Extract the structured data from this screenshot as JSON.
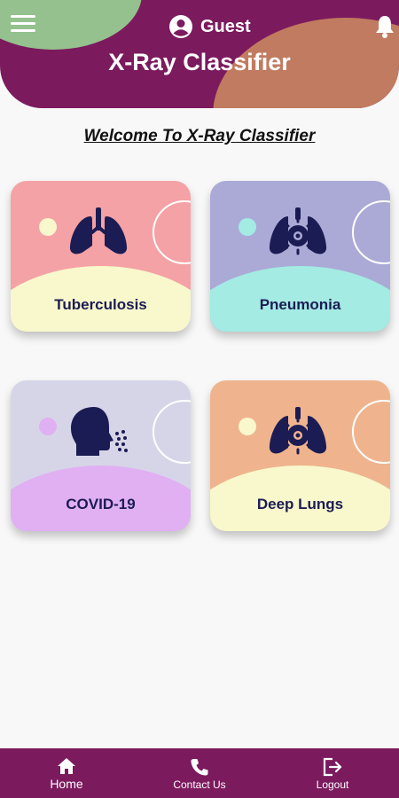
{
  "header": {
    "user": "Guest",
    "title": "X-Ray Classifier"
  },
  "welcome": "Welcome To X-Ray Classifier",
  "cards": [
    {
      "label": "Tuberculosis",
      "bg": "#f4a2a5",
      "arc": "#f8f8cc",
      "dot": "#f8f8cc",
      "icon": "lungs-icon"
    },
    {
      "label": "Pneumonia",
      "bg": "#abaad6",
      "arc": "#a3ebe3",
      "dot": "#a3ebe3",
      "icon": "virus-lungs-icon"
    },
    {
      "label": "COVID-19",
      "bg": "#d6d5e8",
      "arc": "#e0b0f2",
      "dot": "#e0b0f2",
      "icon": "coughing-head-icon"
    },
    {
      "label": "Deep Lungs",
      "bg": "#efb48e",
      "arc": "#f8f8cc",
      "dot": "#f8f8cc",
      "icon": "virus-lungs-icon"
    }
  ],
  "nav": {
    "home": "Home",
    "contact": "Contact Us",
    "logout": "Logout"
  },
  "colors": {
    "primary": "#7c1a5e",
    "icon": "#1c1c54"
  }
}
